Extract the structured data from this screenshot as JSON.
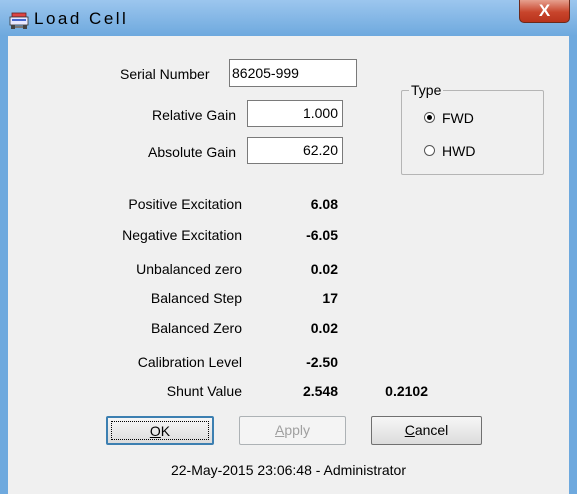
{
  "window": {
    "title": "Load Cell",
    "close_label": "X"
  },
  "serial_number": {
    "label": "Serial Number",
    "value": "86205-999"
  },
  "relative_gain": {
    "label": "Relative Gain",
    "value": "1.000"
  },
  "absolute_gain": {
    "label": "Absolute Gain",
    "value": "62.20"
  },
  "type_group": {
    "legend": "Type",
    "options": [
      {
        "label": "FWD",
        "selected": true
      },
      {
        "label": "HWD",
        "selected": false
      }
    ]
  },
  "readings": [
    {
      "label": "Positive Excitation",
      "value": "6.08"
    },
    {
      "label": "Negative Excitation",
      "value": "-6.05"
    },
    {
      "label": "Unbalanced zero",
      "value": "0.02"
    },
    {
      "label": "Balanced Step",
      "value": "17"
    },
    {
      "label": "Balanced Zero",
      "value": "0.02"
    },
    {
      "label": "Calibration Level",
      "value": "-2.50"
    },
    {
      "label": "Shunt Value",
      "value": "2.548",
      "value2": "0.2102"
    }
  ],
  "buttons": {
    "ok": {
      "accel": "O",
      "rest": "K",
      "enabled": true
    },
    "apply": {
      "accel": "A",
      "rest": "pply",
      "enabled": false
    },
    "cancel": {
      "accel": "C",
      "rest": "ancel",
      "enabled": true
    }
  },
  "footer": {
    "status": "22-May-2015 23:06:48 - Administrator"
  },
  "colors": {
    "title_bar": "#6ea9de",
    "dialog_background": "#f0f0f0",
    "close_button": "#c8452c"
  },
  "icons": {
    "app": "load-cell-app-icon",
    "close": "close-icon"
  }
}
